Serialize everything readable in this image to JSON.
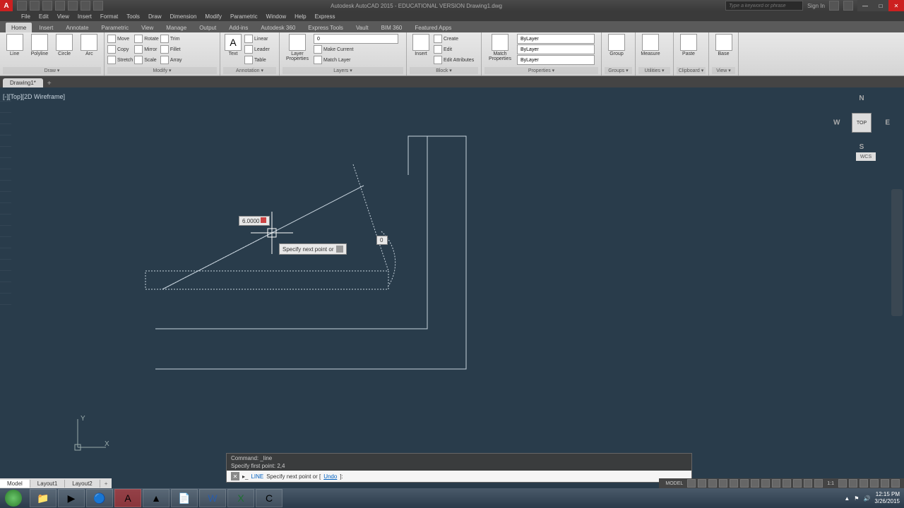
{
  "title_bar": {
    "app_title": "Autodesk AutoCAD 2015 - EDUCATIONAL VERSION   Drawing1.dwg",
    "search_placeholder": "Type a keyword or phrase",
    "sign_in": "Sign In"
  },
  "menu": [
    "File",
    "Edit",
    "View",
    "Insert",
    "Format",
    "Tools",
    "Draw",
    "Dimension",
    "Modify",
    "Parametric",
    "Window",
    "Help",
    "Express"
  ],
  "ribbon_tabs": [
    "Home",
    "Insert",
    "Annotate",
    "Parametric",
    "View",
    "Manage",
    "Output",
    "Add-ins",
    "Autodesk 360",
    "Express Tools",
    "Vault",
    "BIM 360",
    "Featured Apps"
  ],
  "ribbon": {
    "draw": {
      "line": "Line",
      "polyline": "Polyline",
      "circle": "Circle",
      "arc": "Arc",
      "title": "Draw ▾"
    },
    "modify": {
      "move": "Move",
      "rotate": "Rotate",
      "trim": "Trim",
      "copy": "Copy",
      "mirror": "Mirror",
      "fillet": "Fillet",
      "stretch": "Stretch",
      "scale": "Scale",
      "array": "Array",
      "title": "Modify ▾"
    },
    "annotation": {
      "text": "Text",
      "linear": "Linear",
      "leader": "Leader",
      "table": "Table",
      "title": "Annotation ▾"
    },
    "layers": {
      "properties": "Layer\nProperties",
      "sel": "0",
      "title": "Layers ▾"
    },
    "layers2": {
      "make": "Make Current",
      "match": "Match Layer"
    },
    "block": {
      "insert": "Insert",
      "create": "Create",
      "edit": "Edit",
      "editattr": "Edit Attributes",
      "title": "Block ▾"
    },
    "properties": {
      "match": "Match\nProperties",
      "bylayer": "ByLayer",
      "title": "Properties ▾"
    },
    "groups": {
      "group": "Group",
      "title": "Groups ▾"
    },
    "utilities": {
      "measure": "Measure",
      "title": "Utilities ▾"
    },
    "clipboard": {
      "paste": "Paste",
      "title": "Clipboard ▾"
    },
    "view": {
      "base": "Base",
      "title": "View ▾"
    }
  },
  "file_tab": "Drawing1*",
  "viewport_label": "[-][Top][2D Wireframe]",
  "viewcube": {
    "top": "TOP",
    "n": "N",
    "s": "S",
    "e": "E",
    "w": "W",
    "wcs": "WCS"
  },
  "dynamic_input": {
    "distance": "6.0000",
    "angle": "0",
    "prompt": "Specify next point or"
  },
  "ucs": {
    "x": "X",
    "y": "Y"
  },
  "command": {
    "hist1": "Command: _line",
    "hist2": "Specify first point: 2,4",
    "prompt_cmd": "LINE",
    "prompt_text": "Specify next point or [",
    "prompt_opt": "Undo",
    "prompt_close": "]:"
  },
  "layout_tabs": [
    "Model",
    "Layout1",
    "Layout2"
  ],
  "status": {
    "model": "MODEL",
    "scale": "1:1"
  },
  "tray": {
    "time": "12:15 PM",
    "date": "3/26/2015"
  }
}
